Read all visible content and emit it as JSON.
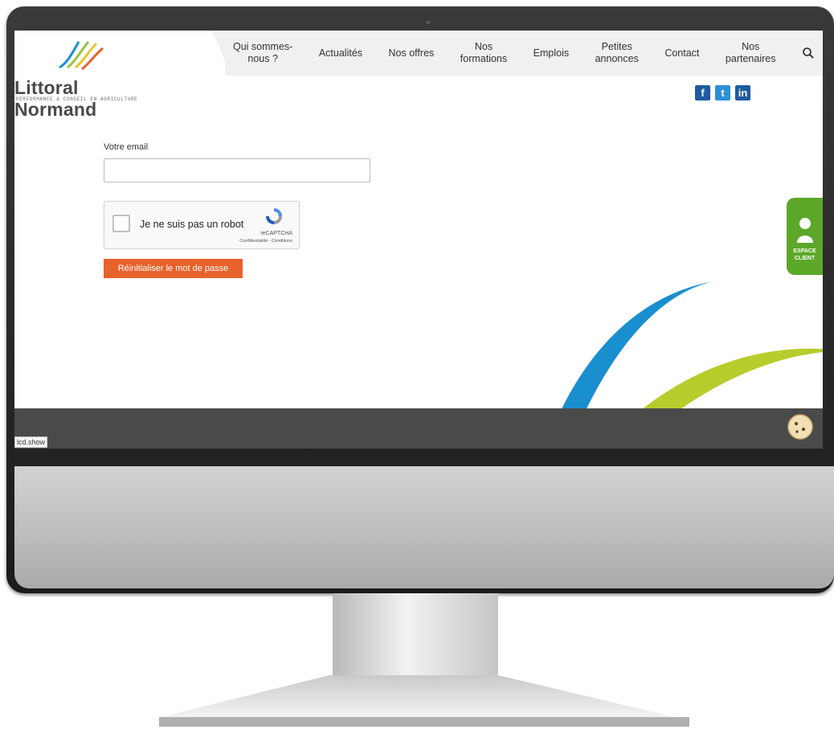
{
  "site": {
    "logo_name": "Littoral Normand",
    "logo_tagline": "PERFORMANCE & CONSEIL EN AGRICULTURE"
  },
  "nav": {
    "items": [
      {
        "label": "Qui sommes-\nnous ?"
      },
      {
        "label": "Actualités"
      },
      {
        "label": "Nos offres"
      },
      {
        "label": "Nos\nformations"
      },
      {
        "label": "Emplois"
      },
      {
        "label": "Petites\nannonces"
      },
      {
        "label": "Contact"
      },
      {
        "label": "Nos\npartenaires"
      }
    ],
    "search_icon": "search-icon"
  },
  "social": {
    "facebook": "f",
    "twitter": "t",
    "linkedin": "in"
  },
  "form": {
    "email_label": "Votre email",
    "email_value": "",
    "captcha_label": "Je ne suis pas un robot",
    "captcha_brand": "reCAPTCHA",
    "captcha_links": "Confidentialité - Conditions",
    "reset_button": "Réinitialiser le mot de passe"
  },
  "espace_client": {
    "line1": "ESPACE",
    "line2": "CLIENT"
  },
  "status_bar": {
    "url": "lcd.show"
  },
  "colors": {
    "accent": "#e8622c",
    "espace_green": "#5ca829",
    "footer": "#4a4a4a"
  }
}
